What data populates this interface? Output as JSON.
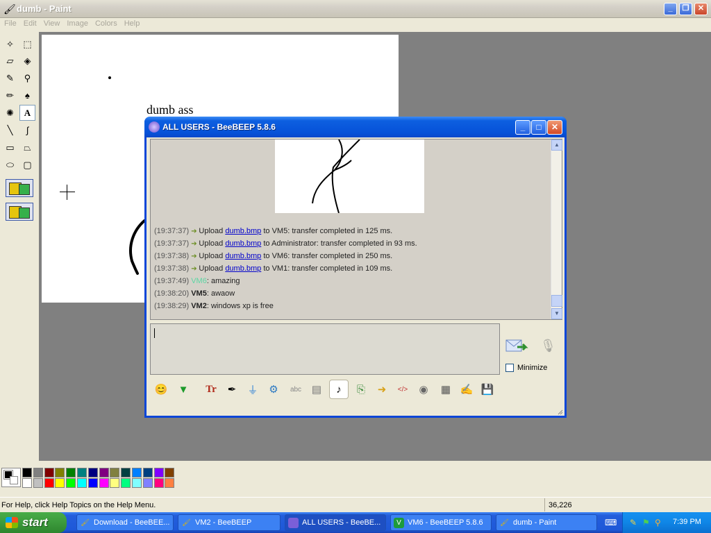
{
  "paint": {
    "title": "dumb - Paint",
    "menu": [
      "File",
      "Edit",
      "View",
      "Image",
      "Colors",
      "Help"
    ],
    "canvas_text": "dumb ass",
    "status_help": "For Help, click Help Topics on the Help Menu.",
    "status_coords": "36,226",
    "palette_top": [
      "#000000",
      "#808080",
      "#800000",
      "#808000",
      "#008000",
      "#008080",
      "#000080",
      "#800080",
      "#808040",
      "#004040",
      "#0080ff",
      "#004080",
      "#8000ff",
      "#804000"
    ],
    "palette_bottom": [
      "#ffffff",
      "#c0c0c0",
      "#ff0000",
      "#ffff00",
      "#00ff00",
      "#00ffff",
      "#0000ff",
      "#ff00ff",
      "#ffff80",
      "#00ff80",
      "#80ffff",
      "#8080ff",
      "#ff0080",
      "#ff8040"
    ]
  },
  "chat": {
    "title": "ALL USERS - BeeBEEP 5.8.6",
    "log": [
      {
        "time": "(19:37:37)",
        "kind": "upload",
        "pre": "Upload ",
        "file": "dumb.bmp",
        "post": " to VM5: transfer completed in 125 ms."
      },
      {
        "time": "(19:37:37)",
        "kind": "upload",
        "pre": "Upload ",
        "file": "dumb.bmp",
        "post": " to Administrator: transfer completed in 93 ms."
      },
      {
        "time": "(19:37:38)",
        "kind": "upload",
        "pre": "Upload ",
        "file": "dumb.bmp",
        "post": " to VM6: transfer completed in 250 ms."
      },
      {
        "time": "(19:37:38)",
        "kind": "upload",
        "pre": "Upload ",
        "file": "dumb.bmp",
        "post": " to VM1: transfer completed in 109 ms."
      },
      {
        "time": "(19:37:49)",
        "kind": "chat",
        "user": "VM6",
        "user_style": "green",
        "text": ": amazing"
      },
      {
        "time": "(19:38:20)",
        "kind": "chat",
        "user": "VM5",
        "user_style": "bold",
        "text": ": awaow"
      },
      {
        "time": "(19:38:29)",
        "kind": "chat",
        "user": "VM2",
        "user_style": "bold",
        "text": ": windows xp is free"
      }
    ],
    "minimize_label": "Minimize"
  },
  "taskbar": {
    "start_label": "start",
    "tasks": [
      {
        "label": "Download - BeeBEE...",
        "icon": "paint-download-icon",
        "active": false
      },
      {
        "label": "VM2 - BeeBEEP",
        "icon": "paint-icon",
        "active": false
      },
      {
        "label": "ALL USERS - BeeBE...",
        "icon": "beebeep-icon",
        "active": true
      },
      {
        "label": "VM6 - BeeBEEP 5.8.6",
        "icon": "vm-icon",
        "active": false
      },
      {
        "label": "dumb - Paint",
        "icon": "paint-icon",
        "active": false
      }
    ],
    "clock": "7:39 PM"
  },
  "colors": {
    "xp_blue": "#0a46d8",
    "link_blue": "#0000cc",
    "vm6_green": "#5cd6a4"
  }
}
